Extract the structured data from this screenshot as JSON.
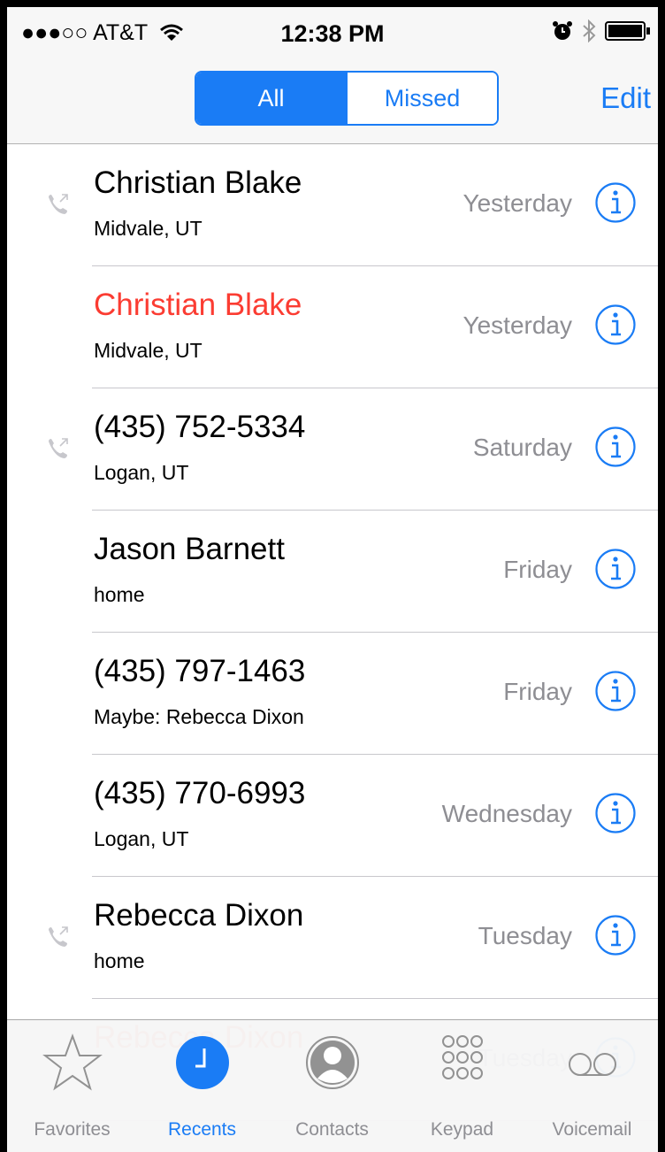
{
  "status_bar": {
    "carrier": "●●●○○ AT&T",
    "time": "12:38 PM"
  },
  "nav": {
    "segment_all": "All",
    "segment_missed": "Missed",
    "edit": "Edit"
  },
  "calls": [
    {
      "name": "Christian Blake",
      "detail": "Midvale, UT",
      "date": "Yesterday",
      "missed": false,
      "outgoing_icon": true
    },
    {
      "name": "Christian Blake",
      "detail": "Midvale, UT",
      "date": "Yesterday",
      "missed": true,
      "outgoing_icon": false
    },
    {
      "name": "(435) 752-5334",
      "detail": "Logan, UT",
      "date": "Saturday",
      "missed": false,
      "outgoing_icon": true
    },
    {
      "name": "Jason Barnett",
      "detail": "home",
      "date": "Friday",
      "missed": false,
      "outgoing_icon": false
    },
    {
      "name": "(435) 797-1463",
      "detail": "Maybe: Rebecca Dixon",
      "date": "Friday",
      "missed": false,
      "outgoing_icon": false
    },
    {
      "name": "(435) 770-6993",
      "detail": "Logan, UT",
      "date": "Wednesday",
      "missed": false,
      "outgoing_icon": false
    },
    {
      "name": "Rebecca Dixon",
      "detail": "home",
      "date": "Tuesday",
      "missed": false,
      "outgoing_icon": true
    },
    {
      "name": "Rebecca Dixon",
      "detail": "",
      "date": "Tuesday",
      "missed": true,
      "outgoing_icon": false
    }
  ],
  "tabs": [
    {
      "label": "Favorites",
      "icon": "star-icon",
      "active": false
    },
    {
      "label": "Recents",
      "icon": "clock-icon",
      "active": true
    },
    {
      "label": "Contacts",
      "icon": "contacts-icon",
      "active": false
    },
    {
      "label": "Keypad",
      "icon": "keypad-icon",
      "active": false
    },
    {
      "label": "Voicemail",
      "icon": "voicemail-icon",
      "active": false
    }
  ],
  "colors": {
    "accent": "#1a7cf5",
    "missed": "#fb3c32",
    "secondary": "#8e8e93"
  }
}
